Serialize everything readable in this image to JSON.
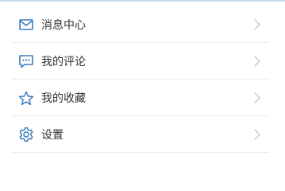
{
  "colors": {
    "icon": "#3a7dbd",
    "text": "#333333",
    "chevron": "#c8c8c8",
    "divider": "#ebebeb",
    "top_bar": "#c9d9ea"
  },
  "menu": {
    "items": [
      {
        "label": "消息中心",
        "icon": "envelope-icon"
      },
      {
        "label": "我的评论",
        "icon": "comment-icon"
      },
      {
        "label": "我的收藏",
        "icon": "star-icon"
      },
      {
        "label": "设置",
        "icon": "gear-icon"
      }
    ]
  }
}
